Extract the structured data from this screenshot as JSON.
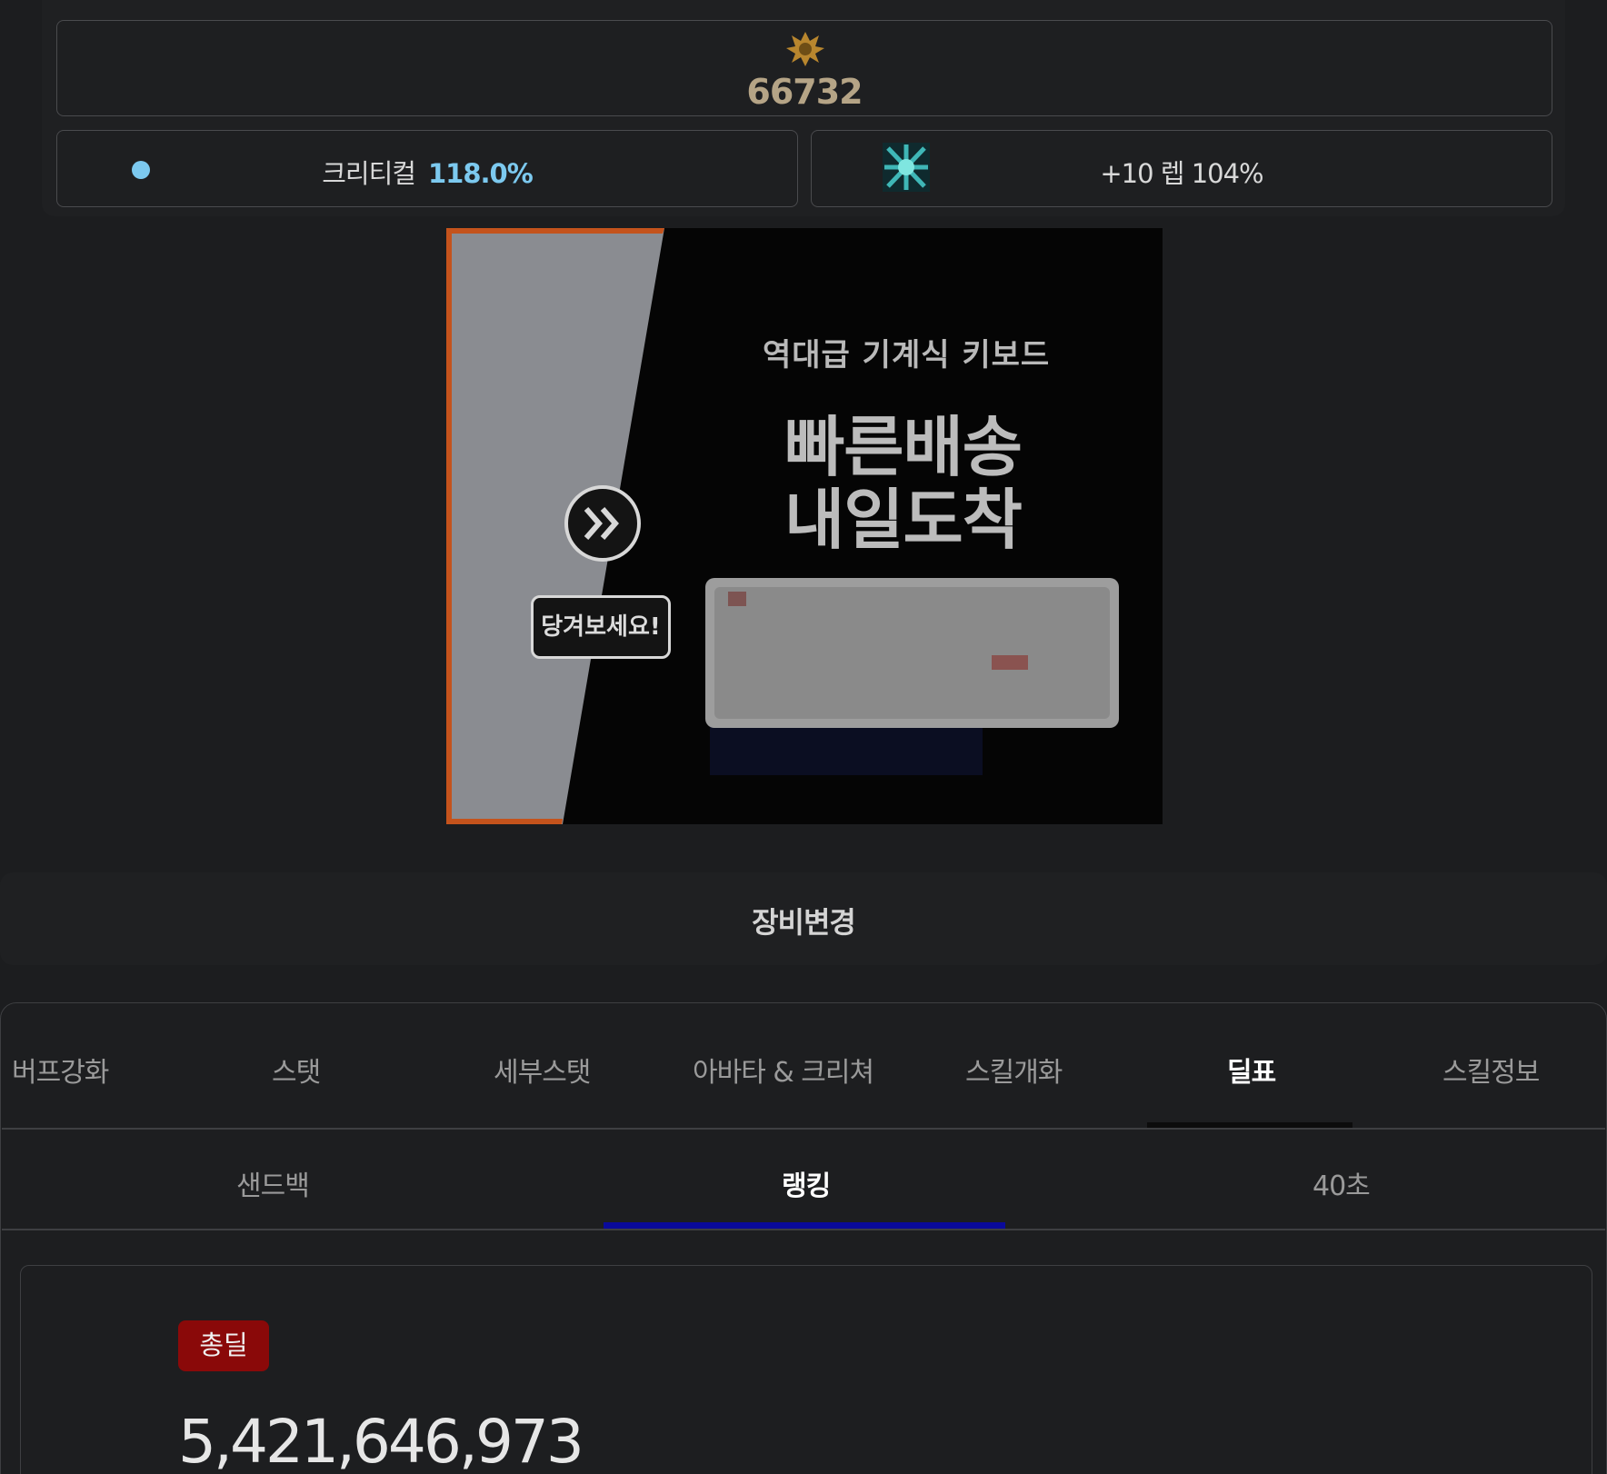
{
  "power": {
    "value": "66732",
    "icon": "gold-emblem-icon"
  },
  "stats": {
    "critical_label": "크리티컬",
    "critical_value": "118.0%",
    "critical_dot_color": "#7cc9ef",
    "rune_text": "+10 렙 104%",
    "rune_icon": "rune-icon"
  },
  "ad": {
    "subtitle": "역대급 기계식 키보드",
    "line1": "빠른배송",
    "line2": "내일도착",
    "bubble": "당겨보세요!",
    "arrow_icon": "double-chevron-icon"
  },
  "equip": {
    "label": "장비변경"
  },
  "tabs": [
    {
      "label": "버프강화"
    },
    {
      "label": "스탯"
    },
    {
      "label": "세부스탯"
    },
    {
      "label": "아바타 & 크리쳐"
    },
    {
      "label": "스킬개화"
    },
    {
      "label": "딜표"
    },
    {
      "label": "스킬정보"
    }
  ],
  "subtabs": [
    {
      "label": "샌드백"
    },
    {
      "label": "랭킹"
    },
    {
      "label": "40초"
    }
  ],
  "result": {
    "badge": "총딜",
    "badge_color": "#8a0909",
    "total": "5,421,646,973"
  }
}
